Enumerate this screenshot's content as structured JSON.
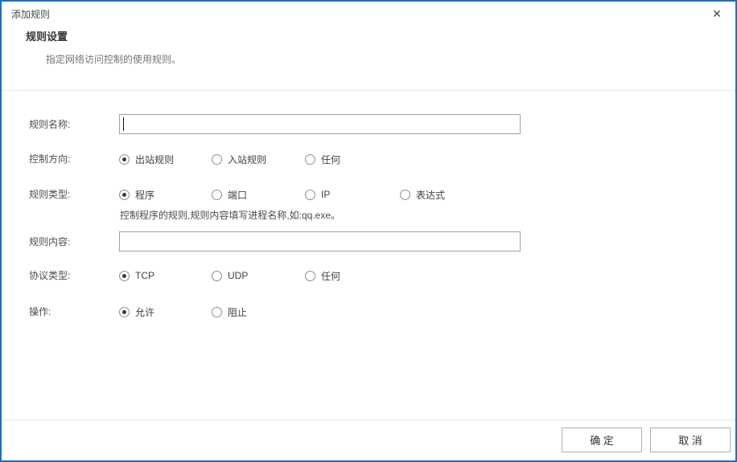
{
  "theme": {
    "accent": "#1673c2",
    "divider": "#e9e9e9",
    "input-border": "#9f9f9f",
    "button-border": "#b0b0b0",
    "text": "#404040"
  },
  "dialog": {
    "title": "添加规则",
    "close_icon": "✕"
  },
  "section": {
    "heading": "规则设置",
    "description": "指定网络访问控制的使用规则。"
  },
  "form": {
    "rows": [
      {
        "label": "规则名称:",
        "type": "text-input",
        "value": "",
        "focused": true
      },
      {
        "label": "控制方向:",
        "type": "radio-group",
        "options": [
          {
            "label": "出站规则",
            "selected": true
          },
          {
            "label": "入站规则",
            "selected": false
          },
          {
            "label": "任何",
            "selected": false
          }
        ]
      },
      {
        "label": "规则类型:",
        "type": "radio-group",
        "options": [
          {
            "label": "程序",
            "selected": true
          },
          {
            "label": "端口",
            "selected": false
          },
          {
            "label": "IP",
            "selected": false
          },
          {
            "label": "表达式",
            "selected": false
          }
        ],
        "hint": "控制程序的规则,规则内容填写进程名称,如:qq.exe。"
      },
      {
        "label": "规则内容:",
        "type": "text-input",
        "value": "",
        "focused": false
      },
      {
        "label": "协议类型:",
        "type": "radio-group",
        "options": [
          {
            "label": "TCP",
            "selected": true
          },
          {
            "label": "UDP",
            "selected": false
          },
          {
            "label": "任何",
            "selected": false
          }
        ]
      },
      {
        "label": "操作:",
        "type": "radio-group",
        "options": [
          {
            "label": "允许",
            "selected": true
          },
          {
            "label": "阻止",
            "selected": false
          }
        ]
      }
    ]
  },
  "footer": {
    "ok": "确 定",
    "cancel": "取 消"
  }
}
